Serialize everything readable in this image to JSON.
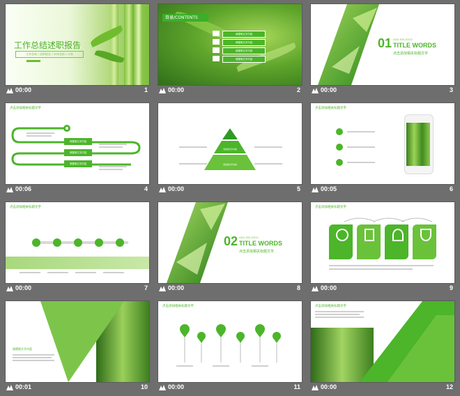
{
  "slides": [
    {
      "num": "1",
      "dur": "00:00",
      "title": "工作总结述职报告",
      "subtitle": "工作总结 | 述职报告 | 年终总结 | 计划"
    },
    {
      "num": "2",
      "dur": "00:00",
      "heading": "目录",
      "heading_en": "/CONTENTS",
      "items": [
        "请替换文字内容",
        "请替换文字内容",
        "请替换文字内容",
        "请替换文字内容"
      ]
    },
    {
      "num": "3",
      "dur": "00:00",
      "big_num": "01",
      "small_en": "ADD RELATED",
      "title_en": "TITLE WORDS",
      "cn": "点击添加相关标题文字"
    },
    {
      "num": "4",
      "dur": "00:06",
      "heading": "点击添加相关标题文字",
      "btns": [
        "请替换文字内容",
        "请替换文字内容",
        "请替换文字内容"
      ]
    },
    {
      "num": "5",
      "dur": "00:00",
      "levels": [
        "请替换文字内容",
        "请替换文字内容",
        "请替换文字内容"
      ]
    },
    {
      "num": "6",
      "dur": "00:05",
      "heading": "点击添加相关标题文字"
    },
    {
      "num": "7",
      "dur": "00:00",
      "heading": "点击添加相关标题文字"
    },
    {
      "num": "8",
      "dur": "00:00",
      "big_num": "02",
      "small_en": "ADD RELATED",
      "title_en": "TITLE WORDS",
      "cn": "点击添加相关标题文字"
    },
    {
      "num": "9",
      "dur": "00:00",
      "heading": "点击添加相关标题文字"
    },
    {
      "num": "10",
      "dur": "00:01",
      "heading": "请替换文字内容"
    },
    {
      "num": "11",
      "dur": "00:00",
      "heading": "点击添加相关标题文字"
    },
    {
      "num": "12",
      "dur": "00:00",
      "heading": "点击添加相关标题文字"
    }
  ],
  "colors": {
    "accent": "#55b128",
    "dark_green": "#2e8b1f",
    "background": "#6e6e6e"
  },
  "icons": {
    "meta_icon": "animation-star-icon"
  }
}
